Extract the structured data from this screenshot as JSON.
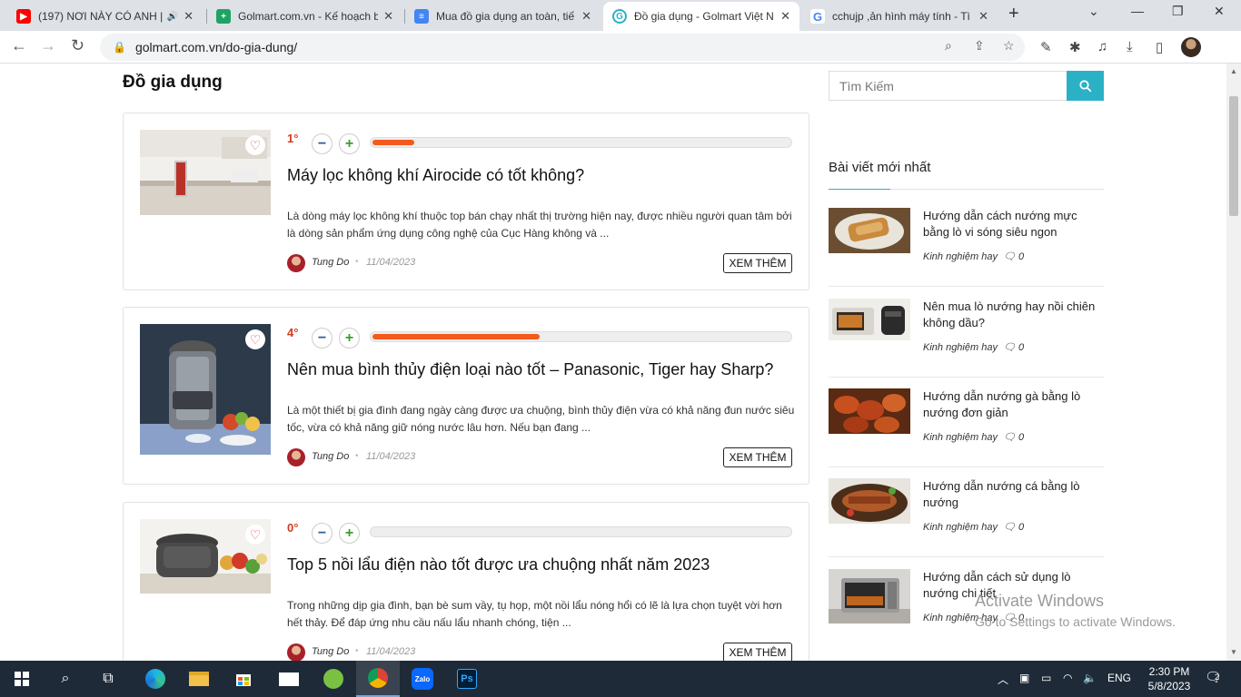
{
  "browser": {
    "tabs": [
      {
        "title": "(197) NƠI NÀY CÓ ANH | ",
        "favicon": "youtube-icon",
        "color": "#ff0000",
        "audio": true
      },
      {
        "title": "Golmart.com.vn - Kế hoạch b",
        "favicon": "sheets-icon",
        "color": "#1ea362",
        "audio": false
      },
      {
        "title": "Mua đồ gia dụng an toàn, tiế",
        "favicon": "docs-icon",
        "color": "#4285f4",
        "audio": false
      },
      {
        "title": "Đồ gia dụng - Golmart Việt N",
        "favicon": "golmart-icon",
        "color": "#2ab1c6",
        "audio": false
      },
      {
        "title": "cchujp ,ản hình máy tính - Tì",
        "favicon": "google-icon",
        "color": "#4285f4",
        "audio": false
      }
    ],
    "url": "golmart.com.vn/do-gia-dung/"
  },
  "page": {
    "title": "Đồ gia dụng",
    "read_more": "XEM THÊM",
    "posts": [
      {
        "votes": "1",
        "vote_fraction": 0.1,
        "title": "Máy lọc không khí Airocide có tốt không?",
        "excerpt": "Là dòng máy lọc không khí thuộc top bán chạy nhất thị trường hiện nay, được nhiều người quan tâm bởi là dòng sản phẩm ứng dụng công nghệ của Cục Hàng không và ...",
        "author": "Tung Do",
        "date": "11/04/2023"
      },
      {
        "votes": "4",
        "vote_fraction": 0.4,
        "title": "Nên mua bình thủy điện loại nào tốt – Panasonic, Tiger hay Sharp?",
        "excerpt": "Là một thiết bị gia đình đang ngày càng được ưa chuộng, bình thủy điện vừa có khả năng đun nước siêu tốc, vừa có khả năng giữ nóng nước lâu hơn. Nếu bạn đang ...",
        "author": "Tung Do",
        "date": "11/04/2023"
      },
      {
        "votes": "0",
        "vote_fraction": 0,
        "title": "Top 5 nồi lẩu điện nào tốt được ưa chuộng nhất năm 2023",
        "excerpt": "Trong những dịp gia đình, bạn bè sum vầy, tụ họp, một nồi lẩu nóng hổi có lẽ là lựa chọn tuyệt vời hơn hết thảy. Để đáp ứng nhu cầu nấu lẩu nhanh chóng, tiện ...",
        "author": "Tung Do",
        "date": "11/04/2023"
      }
    ]
  },
  "sidebar": {
    "search_placeholder": "Tìm Kiếm",
    "recent_heading": "Bài viết mới nhất",
    "recent": [
      {
        "title": "Hướng dẫn cách nướng mực bằng lò vi sóng siêu ngon",
        "category": "Kinh nghiệm hay",
        "comments": "0"
      },
      {
        "title": "Nên mua lò nướng hay nồi chiên không dầu?",
        "category": "Kinh nghiệm hay",
        "comments": "0"
      },
      {
        "title": "Hướng dẫn nướng gà bằng lò nướng đơn giản",
        "category": "Kinh nghiệm hay",
        "comments": "0"
      },
      {
        "title": "Hướng dẫn nướng cá bằng lò nướng",
        "category": "Kinh nghiệm hay",
        "comments": "0"
      },
      {
        "title": "Hướng dẫn cách sử dụng lò nướng chi tiết",
        "category": "Kinh nghiệm hay",
        "comments": "0"
      }
    ]
  },
  "watermark": {
    "line1": "Activate Windows",
    "line2": "Go to Settings to activate Windows."
  },
  "taskbar": {
    "language": "ENG",
    "time": "2:30 PM",
    "date": "5/8/2023",
    "notification_count": "2"
  }
}
